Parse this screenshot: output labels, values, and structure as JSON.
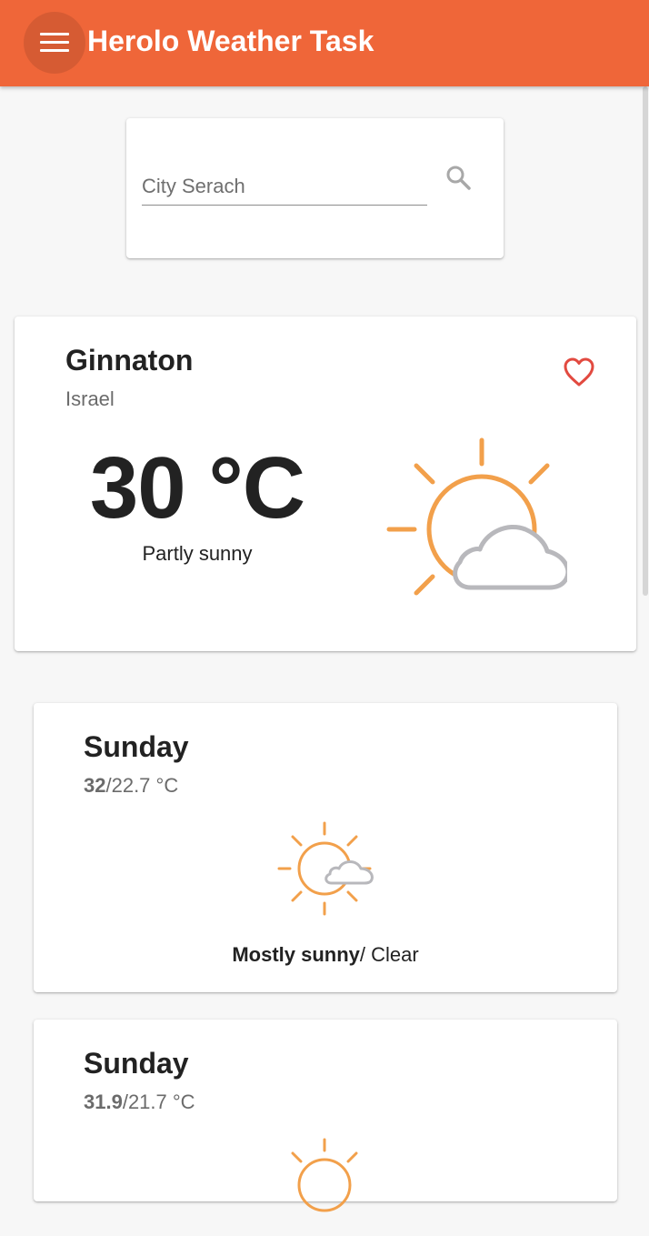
{
  "app": {
    "title": "Herolo Weather Task",
    "accent_color": "#ef6639"
  },
  "search": {
    "placeholder": "City Serach",
    "value": "",
    "icon": "search-icon"
  },
  "current": {
    "city": "Ginnaton",
    "country": "Israel",
    "temperature": "30 °C",
    "weather_text": "Partly sunny",
    "icon": "partly-sunny-icon",
    "favorite_icon": "heart-outline-icon",
    "favorite_color": "#e24a40"
  },
  "forecast": [
    {
      "day": "Sunday",
      "max": "32",
      "min_unit": "/22.7 °C",
      "day_phrase": "Mostly sunny",
      "night_phrase": "/ Clear",
      "icon": "mostly-sunny-icon"
    },
    {
      "day": "Sunday",
      "max": "31.9",
      "min_unit": "/21.7 °C",
      "icon": "sun-icon"
    }
  ]
}
